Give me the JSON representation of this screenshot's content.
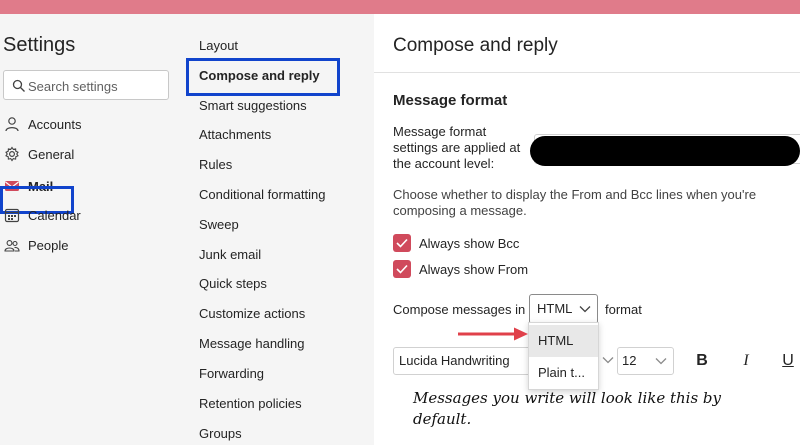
{
  "settings_title": "Settings",
  "search": {
    "placeholder": "Search settings"
  },
  "nav_primary": [
    {
      "label": "Accounts",
      "icon": "person-icon"
    },
    {
      "label": "General",
      "icon": "gear-icon"
    },
    {
      "label": "Mail",
      "icon": "mail-icon",
      "active": true
    },
    {
      "label": "Calendar",
      "icon": "calendar-icon"
    },
    {
      "label": "People",
      "icon": "people-icon"
    }
  ],
  "nav_secondary": [
    "Layout",
    "Compose and reply",
    "Smart suggestions",
    "Attachments",
    "Rules",
    "Conditional formatting",
    "Sweep",
    "Junk email",
    "Quick steps",
    "Customize actions",
    "Message handling",
    "Forwarding",
    "Retention policies",
    "Groups"
  ],
  "pane": {
    "title": "Compose and reply",
    "section_heading": "Message format",
    "format_description": "Message format settings are applied at the account level:",
    "choose_description": "Choose whether to display the From and Bcc lines when you're composing a message.",
    "checkboxes": [
      {
        "label": "Always show Bcc",
        "checked": true
      },
      {
        "label": "Always show From",
        "checked": true
      }
    ],
    "compose_label": "Compose messages in",
    "format_suffix": "format",
    "format_selected": "HTML",
    "format_options": [
      "HTML",
      "Plain t..."
    ],
    "font_name": "Lucida Handwriting",
    "font_size": "12",
    "bold_label": "B",
    "italic_label": "I",
    "underline_label": "U",
    "preview_text": "Messages you write will look like this by default."
  },
  "colors": {
    "accent": "#d04a5c",
    "highlight_box": "#1144cc",
    "topbar": "#e07b8a",
    "arrow": "#e0404a"
  }
}
